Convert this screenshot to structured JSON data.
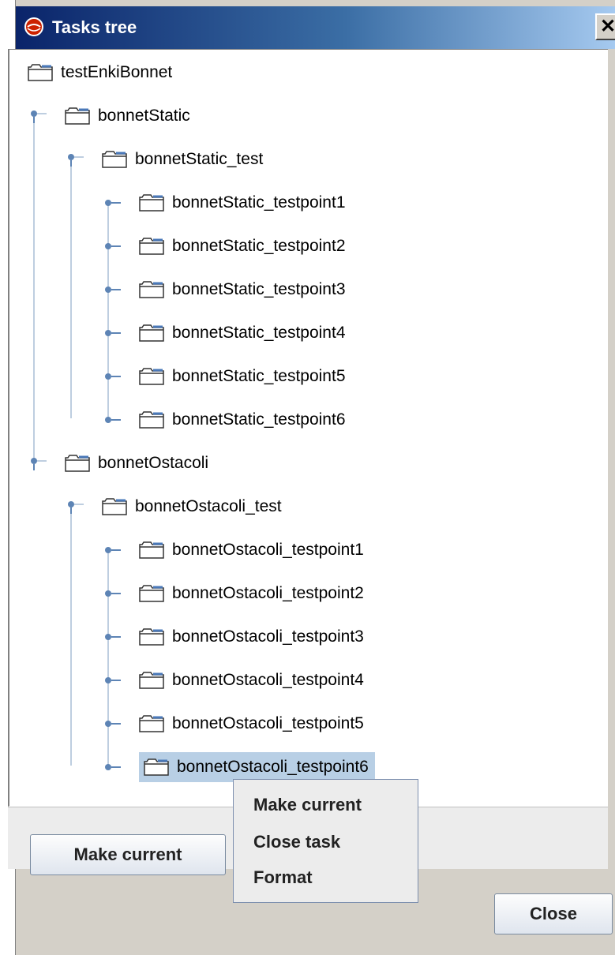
{
  "window": {
    "title": "Tasks tree",
    "close_glyph": "✕",
    "app_icon": "red-sphere-icon"
  },
  "tree": {
    "root": "testEnkiBonnet",
    "groups": [
      {
        "label": "bonnetStatic",
        "test": "bonnetStatic_test",
        "points": [
          "bonnetStatic_testpoint1",
          "bonnetStatic_testpoint2",
          "bonnetStatic_testpoint3",
          "bonnetStatic_testpoint4",
          "bonnetStatic_testpoint5",
          "bonnetStatic_testpoint6"
        ]
      },
      {
        "label": "bonnetOstacoli",
        "test": "bonnetOstacoli_test",
        "points": [
          "bonnetOstacoli_testpoint1",
          "bonnetOstacoli_testpoint2",
          "bonnetOstacoli_testpoint3",
          "bonnetOstacoli_testpoint4",
          "bonnetOstacoli_testpoint5",
          "bonnetOstacoli_testpoint6"
        ]
      }
    ],
    "selected": "bonnetOstacoli_testpoint6"
  },
  "buttons": {
    "make_current": "Make current",
    "close": "Close"
  },
  "context_menu": {
    "items": [
      "Make current",
      "Close task",
      "Format"
    ]
  },
  "colors": {
    "selection": "#b8cfe5",
    "tree_line": "#7f9db9",
    "title_start": "#0a246a",
    "title_end": "#a6caf0"
  }
}
